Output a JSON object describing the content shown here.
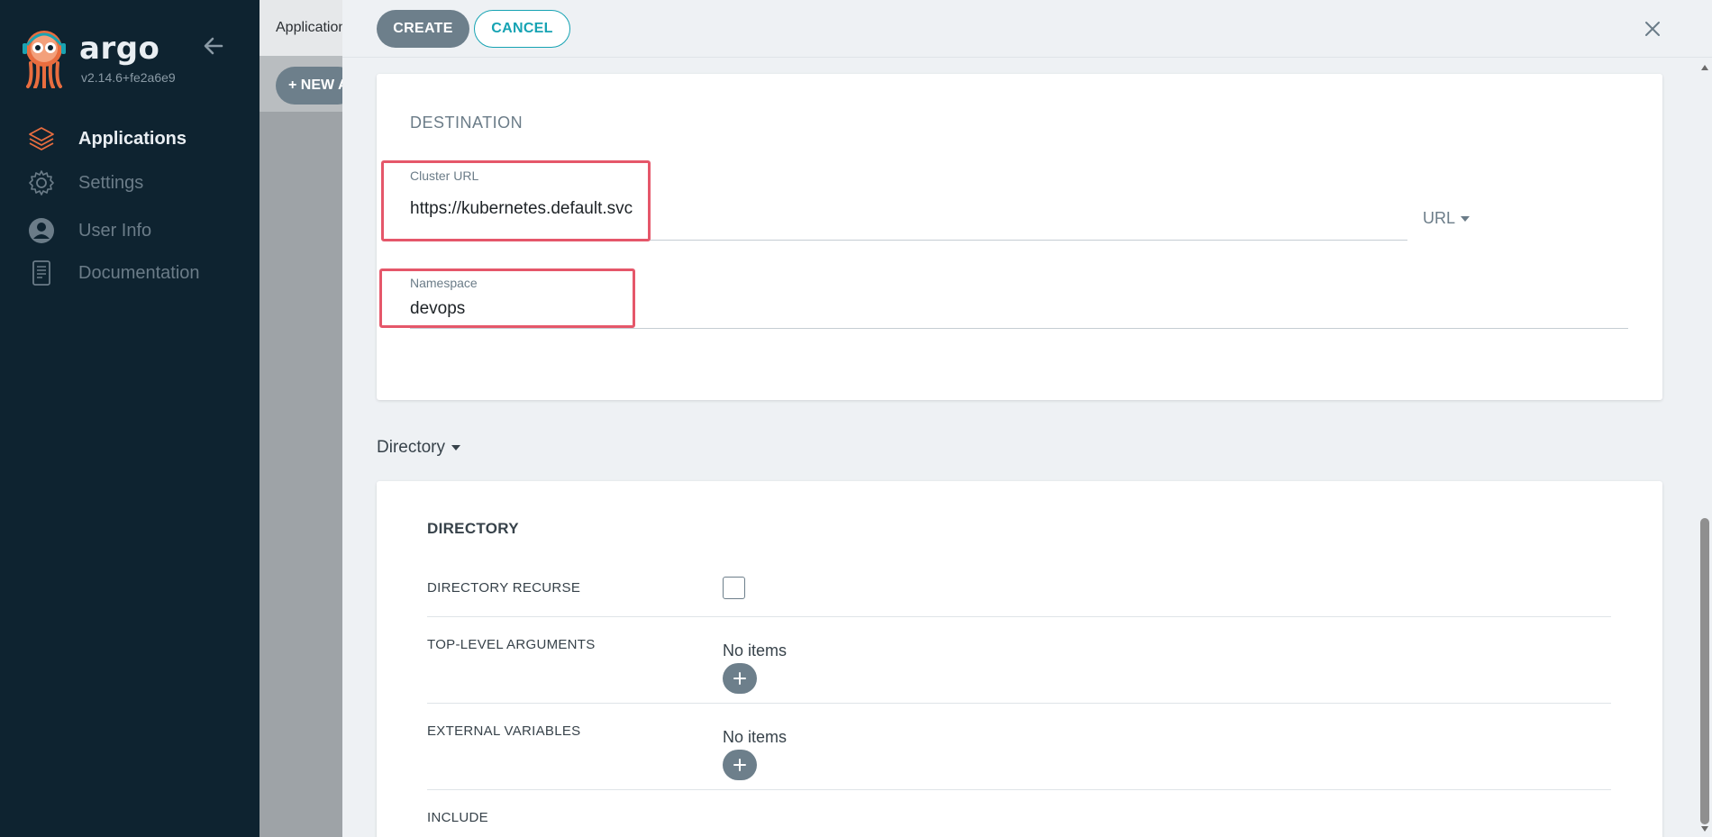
{
  "sidebar": {
    "brand": "argo",
    "version": "v2.14.6+fe2a6e9",
    "items": [
      {
        "label": "Applications",
        "icon": "layers-icon",
        "active": true
      },
      {
        "label": "Settings",
        "icon": "gear-icon",
        "active": false
      },
      {
        "label": "User Info",
        "icon": "user-icon",
        "active": false
      },
      {
        "label": "Documentation",
        "icon": "book-icon",
        "active": false
      }
    ]
  },
  "background_page": {
    "title": "Applications",
    "new_app_button": "+ NEW APP"
  },
  "panel": {
    "create_label": "CREATE",
    "cancel_label": "CANCEL",
    "destination": {
      "section_title": "DESTINATION",
      "cluster_url_label": "Cluster URL",
      "cluster_url_value": "https://kubernetes.default.svc",
      "url_type": "URL",
      "namespace_label": "Namespace",
      "namespace_value": "devops"
    },
    "source_type": "Directory",
    "directory": {
      "title": "DIRECTORY",
      "recurse_label": "DIRECTORY RECURSE",
      "recurse_checked": false,
      "top_level_label": "TOP-LEVEL ARGUMENTS",
      "top_level_value": "No items",
      "external_label": "EXTERNAL VARIABLES",
      "external_value": "No items",
      "include_label": "INCLUDE"
    }
  },
  "colors": {
    "sidebar_bg": "#0e2330",
    "accent_teal": "#16a3b3",
    "button_gray": "#6d7f8b",
    "highlight_red": "#e5576a",
    "argo_orange": "#e96d3f"
  }
}
